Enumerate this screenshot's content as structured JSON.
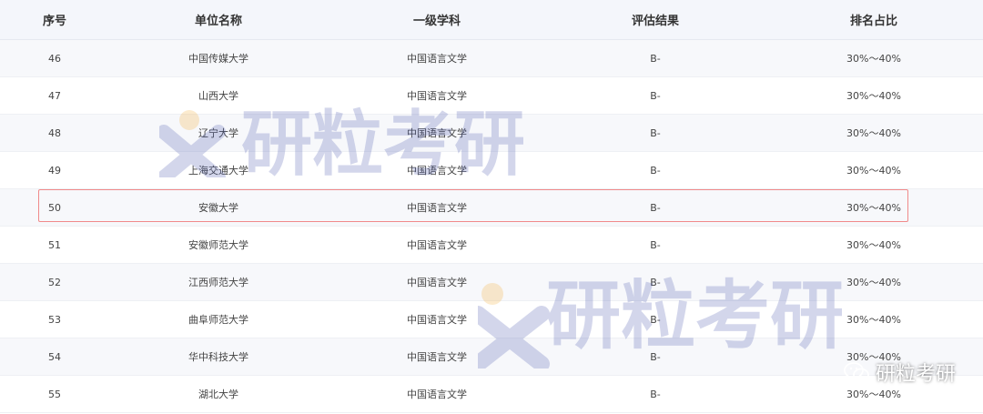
{
  "table": {
    "headers": [
      "序号",
      "单位名称",
      "一级学科",
      "评估结果",
      "排名占比"
    ],
    "rows": [
      [
        "46",
        "中国传媒大学",
        "中国语言文学",
        "B-",
        "30%～40%"
      ],
      [
        "47",
        "山西大学",
        "中国语言文学",
        "B-",
        "30%～40%"
      ],
      [
        "48",
        "辽宁大学",
        "中国语言文学",
        "B-",
        "30%～40%"
      ],
      [
        "49",
        "上海交通大学",
        "中国语言文学",
        "B-",
        "30%～40%"
      ],
      [
        "50",
        "安徽大学",
        "中国语言文学",
        "B-",
        "30%～40%"
      ],
      [
        "51",
        "安徽师范大学",
        "中国语言文学",
        "B-",
        "30%～40%"
      ],
      [
        "52",
        "江西师范大学",
        "中国语言文学",
        "B-",
        "30%～40%"
      ],
      [
        "53",
        "曲阜师范大学",
        "中国语言文学",
        "B-",
        "30%～40%"
      ],
      [
        "54",
        "华中科技大学",
        "中国语言文学",
        "B-",
        "30%～40%"
      ],
      [
        "55",
        "湖北大学",
        "中国语言文学",
        "B-",
        "30%～40%"
      ]
    ],
    "highlighted_row": "50"
  },
  "watermark": {
    "brand_text": "研粒考研",
    "colors": {
      "brand": "#3b4aa8",
      "accent": "#f5a623"
    }
  },
  "badge": {
    "text": "研粒考研",
    "icon": "wechat-icon"
  },
  "colors": {
    "highlight_border": "#f08a8a",
    "header_bg": "#f4f6fb",
    "row_alt_bg": "#f7f8fb"
  }
}
